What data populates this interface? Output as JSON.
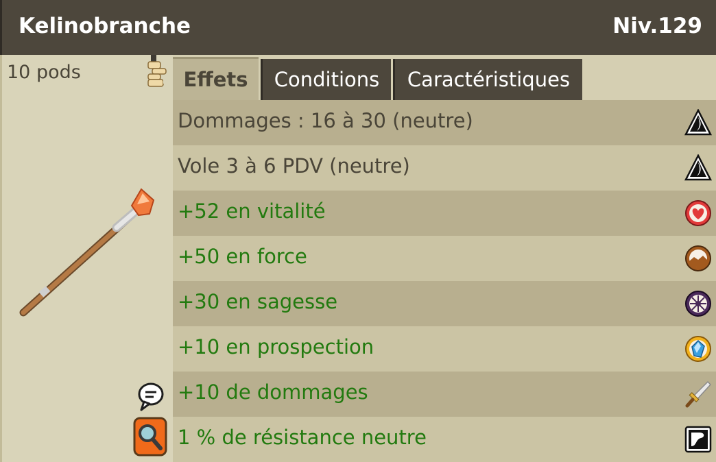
{
  "item": {
    "name": "Kelinobranche",
    "level": "Niv.129",
    "weight": "10 pods"
  },
  "tabs": [
    {
      "label": "Effets",
      "active": true
    },
    {
      "label": "Conditions",
      "active": false
    },
    {
      "label": "Caractéristiques",
      "active": false
    }
  ],
  "effects": [
    {
      "text": "Dommages : 16 à 30 (neutre)",
      "kind": "neutral",
      "icon": "neutral-element-icon"
    },
    {
      "text": "Vole 3 à 6 PDV (neutre)",
      "kind": "neutral",
      "icon": "neutral-element-icon"
    },
    {
      "text": "+52 en vitalité",
      "kind": "bonus",
      "icon": "heart-icon"
    },
    {
      "text": "+50 en force",
      "kind": "bonus",
      "icon": "earth-icon"
    },
    {
      "text": "+30 en sagesse",
      "kind": "bonus",
      "icon": "wisdom-icon"
    },
    {
      "text": "+10 en prospection",
      "kind": "bonus",
      "icon": "crystal-icon"
    },
    {
      "text": "+10 de dommages",
      "kind": "bonus",
      "icon": "sword-icon"
    },
    {
      "text": "1 % de résistance neutre",
      "kind": "bonus",
      "icon": "neutral-resistance-icon"
    }
  ],
  "colors": {
    "header_bg": "#4d473c",
    "neutral_text": "#4a4538",
    "bonus_text": "#227a0f"
  }
}
